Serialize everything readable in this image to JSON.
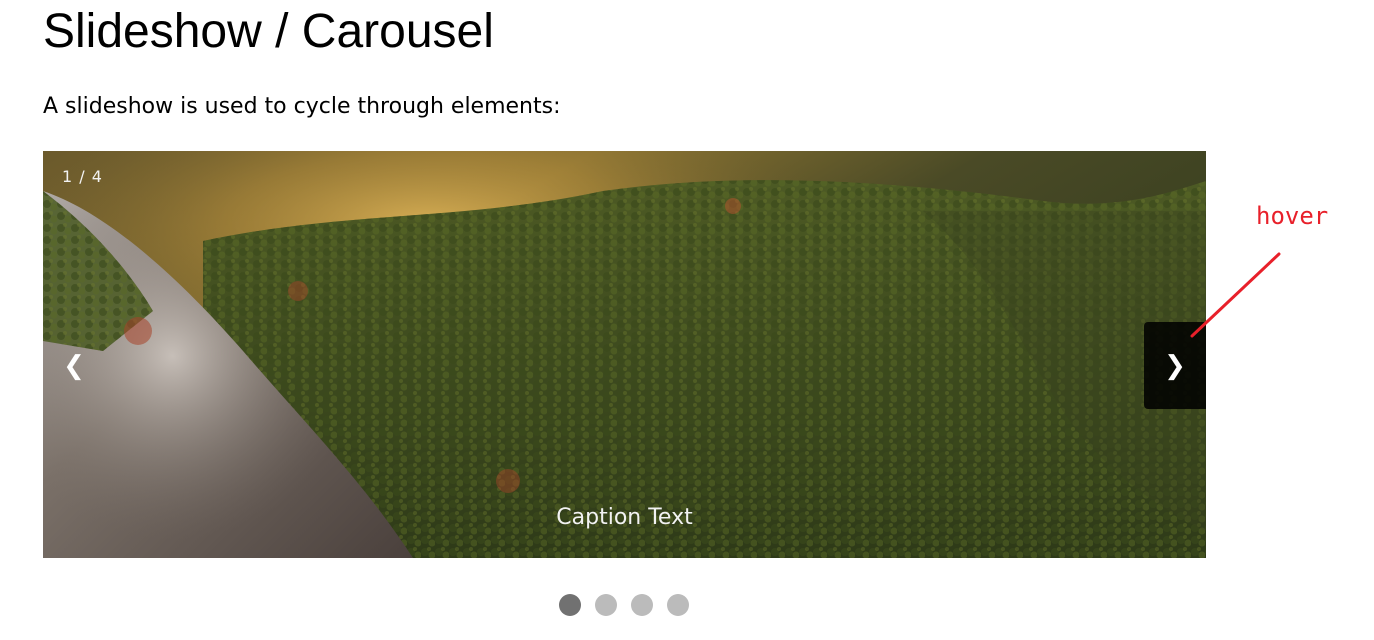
{
  "page": {
    "title": "Slideshow / Carousel",
    "intro": "A slideshow is used to cycle through elements:"
  },
  "slideshow": {
    "counter": "1 / 4",
    "caption": "Caption Text",
    "prev_symbol": "❮",
    "next_symbol": "❯",
    "current_slide": 1,
    "total_slides": 4,
    "image_subject": "aerial view of forested hills with misty valley and granite cliff"
  },
  "annotation": {
    "label": "hover",
    "color": "#e8202a"
  },
  "colors": {
    "dot_active": "#717171",
    "dot_inactive": "#bbbbbb",
    "caption_text": "#f2f2f2"
  }
}
